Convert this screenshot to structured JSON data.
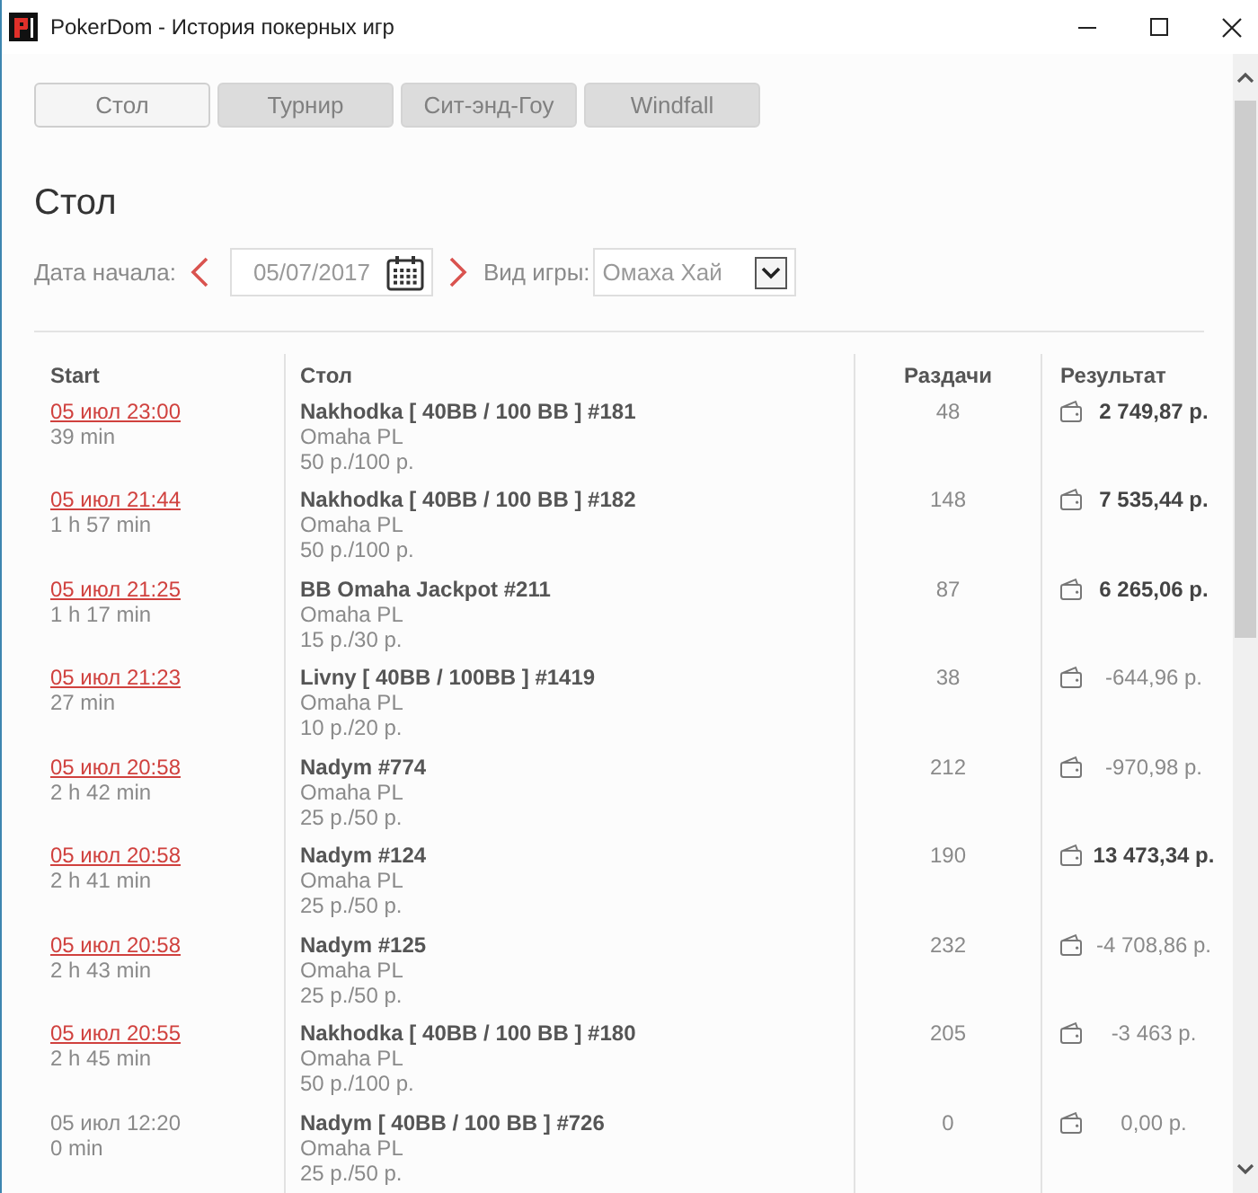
{
  "window": {
    "title": "PokerDom - История покерных игр"
  },
  "tabs": [
    {
      "label": "Стол",
      "selected": true
    },
    {
      "label": "Турнир",
      "selected": false
    },
    {
      "label": "Сит-энд-Гоу",
      "selected": false
    },
    {
      "label": "Windfall",
      "selected": false
    }
  ],
  "section_title": "Стол",
  "filters": {
    "date_label": "Дата начала:",
    "date_value": "05/07/2017",
    "game_label": "Вид игры:",
    "game_value": "Омаха Хай"
  },
  "table": {
    "columns": [
      "Start",
      "Стол",
      "Раздачи",
      "Результат"
    ],
    "rows": [
      {
        "start": "05 июл 23:00",
        "linked": true,
        "duration": "39 min",
        "table": "Nakhodka [ 40BB / 100 BB ] #181",
        "game": "Omaha PL",
        "stakes": "50 р./100 р.",
        "hands": "48",
        "result": "2 749,87 р.",
        "win": true
      },
      {
        "start": "05 июл 21:44",
        "linked": true,
        "duration": "1 h 57 min",
        "table": "Nakhodka [ 40BB / 100 BB ] #182",
        "game": "Omaha PL",
        "stakes": "50 р./100 р.",
        "hands": "148",
        "result": "7 535,44 р.",
        "win": true
      },
      {
        "start": "05 июл 21:25",
        "linked": true,
        "duration": "1 h 17 min",
        "table": "BB Omaha Jackpot #211",
        "game": "Omaha PL",
        "stakes": "15 р./30 р.",
        "hands": "87",
        "result": "6 265,06 р.",
        "win": true
      },
      {
        "start": "05 июл 21:23",
        "linked": true,
        "duration": "27 min",
        "table": "Livny [ 40BB / 100BB ] #1419",
        "game": "Omaha PL",
        "stakes": "10 р./20 р.",
        "hands": "38",
        "result": "-644,96 р.",
        "win": false
      },
      {
        "start": "05 июл 20:58",
        "linked": true,
        "duration": "2 h 42 min",
        "table": "Nadym #774",
        "game": "Omaha PL",
        "stakes": "25 р./50 р.",
        "hands": "212",
        "result": "-970,98 р.",
        "win": false
      },
      {
        "start": "05 июл 20:58",
        "linked": true,
        "duration": "2 h 41 min",
        "table": "Nadym #124",
        "game": "Omaha PL",
        "stakes": "25 р./50 р.",
        "hands": "190",
        "result": "13 473,34 р.",
        "win": true
      },
      {
        "start": "05 июл 20:58",
        "linked": true,
        "duration": "2 h 43 min",
        "table": "Nadym #125",
        "game": "Omaha PL",
        "stakes": "25 р./50 р.",
        "hands": "232",
        "result": "-4 708,86 р.",
        "win": false
      },
      {
        "start": "05 июл 20:55",
        "linked": true,
        "duration": "2 h 45 min",
        "table": "Nakhodka [ 40BB / 100 BB ] #180",
        "game": "Omaha PL",
        "stakes": "50 р./100 р.",
        "hands": "205",
        "result": "-3 463 р.",
        "win": false
      },
      {
        "start": "05 июл 12:20",
        "linked": false,
        "duration": "0 min",
        "table": "Nadym [ 40BB / 100 BB ] #726",
        "game": "Omaha PL",
        "stakes": "25 р./50 р.",
        "hands": "0",
        "result": "0,00 р.",
        "win": false
      }
    ]
  }
}
